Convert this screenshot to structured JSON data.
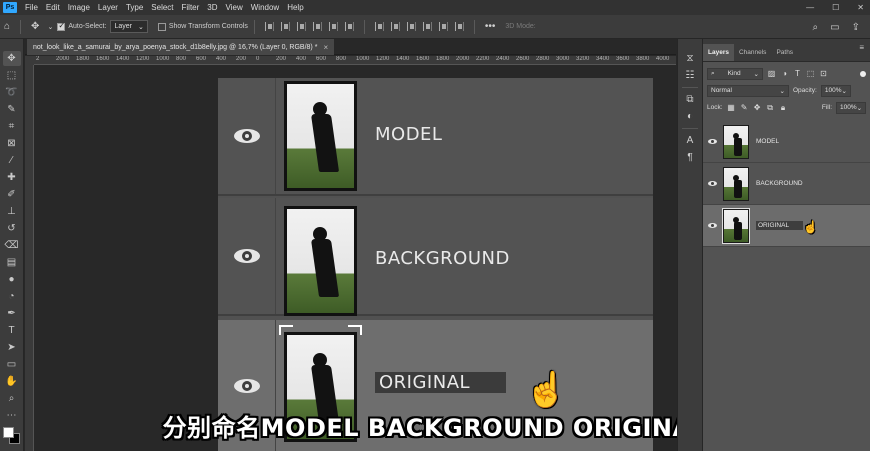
{
  "app": {
    "logo": "Ps",
    "menu": [
      "File",
      "Edit",
      "Image",
      "Layer",
      "Type",
      "Select",
      "Filter",
      "3D",
      "View",
      "Window",
      "Help"
    ],
    "window_controls": [
      "—",
      "☐",
      "✕"
    ]
  },
  "options_bar": {
    "auto_select_label": "Auto-Select:",
    "auto_select_value": "Layer",
    "show_transform_label": "Show Transform Controls",
    "more": "•••",
    "mode_3d": "3D Mode:"
  },
  "document": {
    "tab_title": "not_look_like_a_samurai_by_arya_poenya_stock_d1b8elly.jpg @ 16,7% (Layer 0, RGB/8) *",
    "close": "×",
    "ruler_numbers": [
      "2",
      "2000",
      "1800",
      "1600",
      "1400",
      "1200",
      "1000",
      "800",
      "600",
      "400",
      "200",
      "0",
      "200",
      "400",
      "600",
      "800",
      "1000",
      "1200",
      "1400",
      "1600",
      "1800",
      "2000",
      "2200",
      "2400",
      "2600",
      "2800",
      "3000",
      "3200",
      "3400",
      "3600",
      "3800",
      "4000"
    ]
  },
  "zoomed_layers": [
    {
      "name": "MODEL"
    },
    {
      "name": "BACKGROUND"
    },
    {
      "name": "ORIGINAL"
    }
  ],
  "subtitle": "分别命名MODEL BACKGROUND ORIGINAL",
  "layers_panel": {
    "tabs": [
      "Layers",
      "Channels",
      "Paths"
    ],
    "filter_kind": "Kind",
    "blend_mode": "Normal",
    "opacity_label": "Opacity:",
    "opacity_value": "100%",
    "lock_label": "Lock:",
    "fill_label": "Fill:",
    "fill_value": "100%",
    "layers": [
      {
        "name": "MODEL",
        "selected": false
      },
      {
        "name": "BACKGROUND",
        "selected": false
      },
      {
        "name": "ORIGINAL",
        "selected": true
      }
    ]
  },
  "colors": {
    "accent": "#31a8ff",
    "panel_bg": "#535353",
    "selected_row": "#6c6c6c",
    "chrome": "#3c3c3c"
  }
}
